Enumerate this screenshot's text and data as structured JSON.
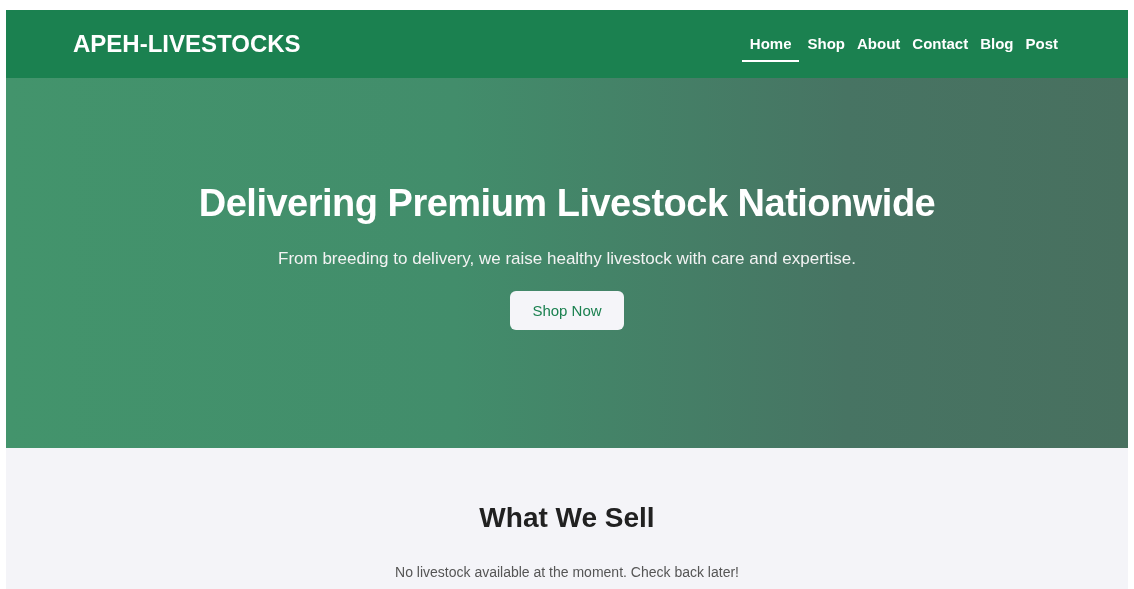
{
  "header": {
    "logo": "APEH-LIVESTOCKS",
    "nav": [
      {
        "label": "Home",
        "selected": true
      },
      {
        "label": "Shop",
        "selected": false
      },
      {
        "label": "About",
        "selected": false
      },
      {
        "label": "Contact",
        "selected": false
      },
      {
        "label": "Blog",
        "selected": false
      },
      {
        "label": "Post",
        "selected": false
      }
    ]
  },
  "hero": {
    "title": "Delivering Premium Livestock Nationwide",
    "subtitle": "From breeding to delivery, we raise healthy livestock with care and expertise.",
    "button": "Shop Now"
  },
  "products": {
    "heading": "What We Sell",
    "empty_message": "No livestock available at the moment. Check back later!"
  }
}
